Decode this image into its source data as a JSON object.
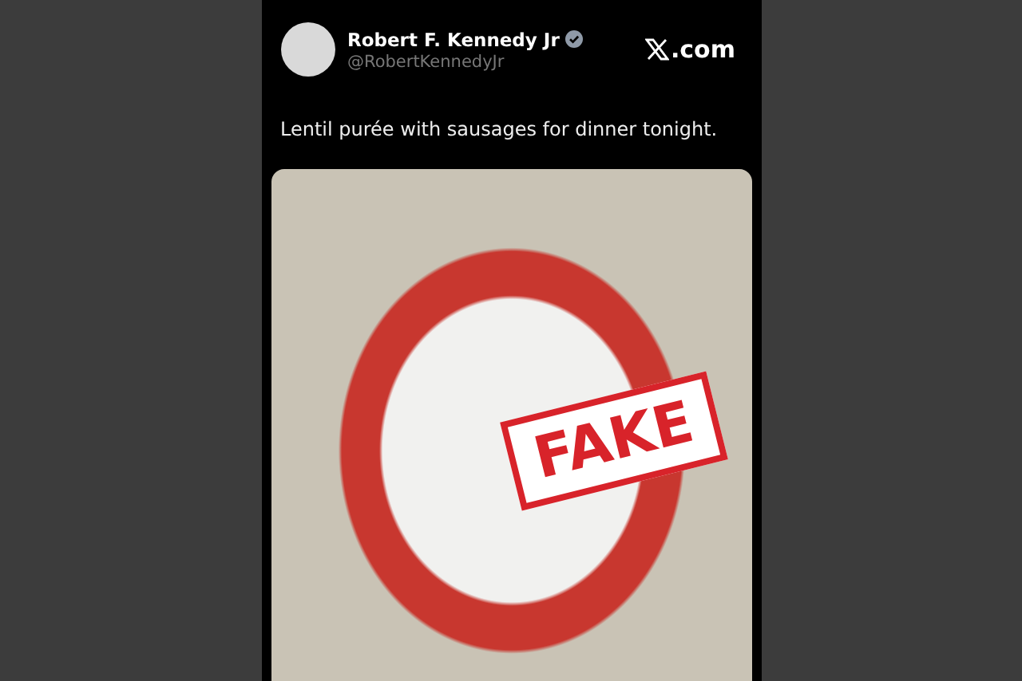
{
  "post": {
    "author_name": "Robert F. Kennedy Jr",
    "verified": true,
    "handle": "@RobertKennedyJr",
    "site_suffix": ".com",
    "text": "Lentil purée with sausages for dinner tonight."
  },
  "stamp": {
    "label": "FAKE"
  }
}
